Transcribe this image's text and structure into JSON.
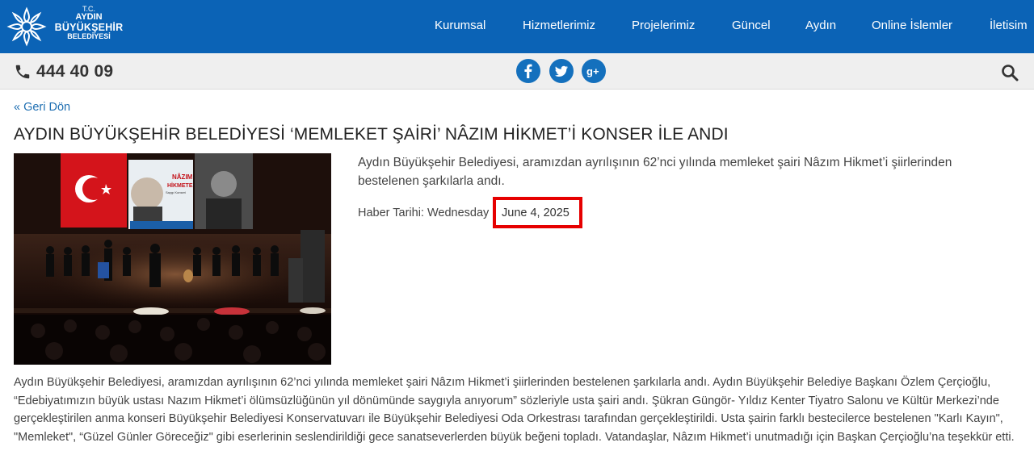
{
  "header": {
    "logo": {
      "line1": "T.C.",
      "line2": "AYDIN",
      "line3": "BÜYÜKŞEHİR",
      "line4": "BELEDİYESİ"
    },
    "nav": [
      "Kurumsal",
      "Hizmetlerimiz",
      "Projelerimiz",
      "Güncel",
      "Aydın",
      "Online İslemler",
      "İletisim"
    ],
    "brand_color": "#0b63b6"
  },
  "subbar": {
    "phone_icon": "phone-icon",
    "phone": "444 40 09",
    "social": [
      {
        "name": "facebook-icon",
        "glyph": "f"
      },
      {
        "name": "twitter-icon",
        "glyph": "t"
      },
      {
        "name": "google-plus-icon",
        "glyph": "g+"
      }
    ],
    "search_icon": "search-icon"
  },
  "article": {
    "back_link": "« Geri Dön",
    "title": "AYDIN BÜYÜKŞEHİR BELEDİYESİ ‘MEMLEKET ŞAİRİ’ NÂZIM HİKMET’İ KONSER İLE ANDI",
    "summary": "Aydın Büyükşehir Belediyesi, aramızdan ayrılışının 62’nci yılında memleket şairi Nâzım Hikmet’i şiirlerinden bestelenen şarkılarla andı.",
    "date_label": "Haber Tarihi: Wednesday",
    "date_value": "June 4, 2025",
    "highlight_color": "#e60000",
    "body": "Aydın Büyükşehir Belediyesi, aramızdan ayrılışının 62’nci yılında memleket şairi Nâzım Hikmet’i şiirlerinden bestelenen şarkılarla andı. Aydın Büyükşehir Belediye Başkanı Özlem Çerçioğlu, “Edebiyatımızın büyük ustası Nazım Hikmet’i ölümsüzlüğünün yıl dönümünde saygıyla anıyorum” sözleriyle usta şairi andı. Şükran Güngör- Yıldız Kenter Tiyatro Salonu ve Kültür Merkezi’nde gerçekleştirilen anma konseri Büyükşehir Belediyesi Konservatuvarı ile Büyükşehir Belediyesi Oda Orkestrası tarafından gerçekleştirildi. Usta şairin farklı bestecilerce bestelenen \"Karlı Kayın\", \"Memleket\", “Güzel Günler Göreceğiz\" gibi eserlerinin seslendirildiği gece sanatseverlerden büyük beğeni topladı. Vatandaşlar, Nâzım Hikmet’i unutmadığı için Başkan Çerçioğlu’na teşekkür etti.",
    "photo_banner": {
      "line1": "NÂZIM",
      "line2": "HİKMETE",
      "line3": "Saygı Konseri"
    }
  }
}
